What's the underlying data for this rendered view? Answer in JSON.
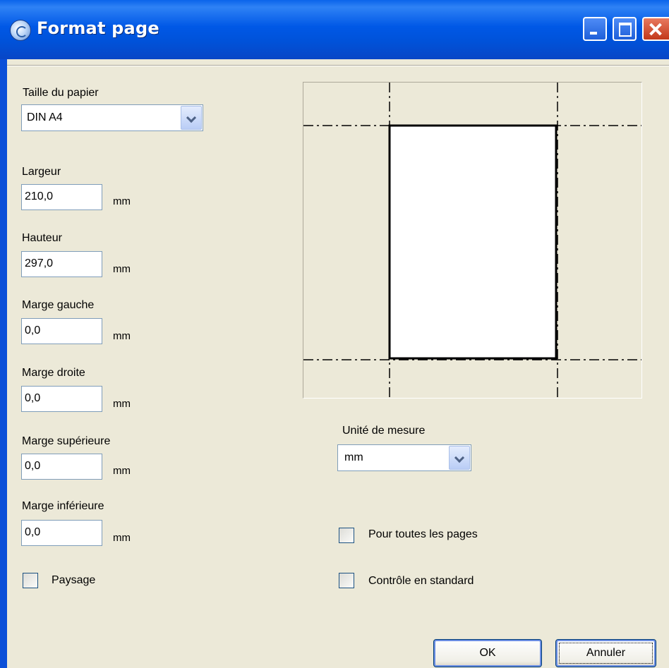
{
  "window": {
    "title": "Format page"
  },
  "paper": {
    "size_label": "Taille du papier",
    "size_value": "DIN A4"
  },
  "fields": [
    {
      "label": "Largeur",
      "value": "210,0",
      "unit": "mm"
    },
    {
      "label": "Hauteur",
      "value": "297,0",
      "unit": "mm"
    },
    {
      "label": "Marge gauche",
      "value": "0,0",
      "unit": "mm"
    },
    {
      "label": "Marge droite",
      "value": "0,0",
      "unit": "mm"
    },
    {
      "label": "Marge supérieure",
      "value": "0,0",
      "unit": "mm"
    },
    {
      "label": "Marge inférieure",
      "value": "0,0",
      "unit": "mm"
    }
  ],
  "landscape": {
    "label": "Paysage",
    "checked": false
  },
  "measure_unit": {
    "label": "Unité de mesure",
    "value": "mm"
  },
  "options": {
    "all_pages": {
      "label": "Pour toutes les pages",
      "checked": false
    },
    "standard_check": {
      "label": "Contrôle en standard",
      "checked": false
    }
  },
  "buttons": {
    "ok": "OK",
    "cancel": "Annuler"
  }
}
